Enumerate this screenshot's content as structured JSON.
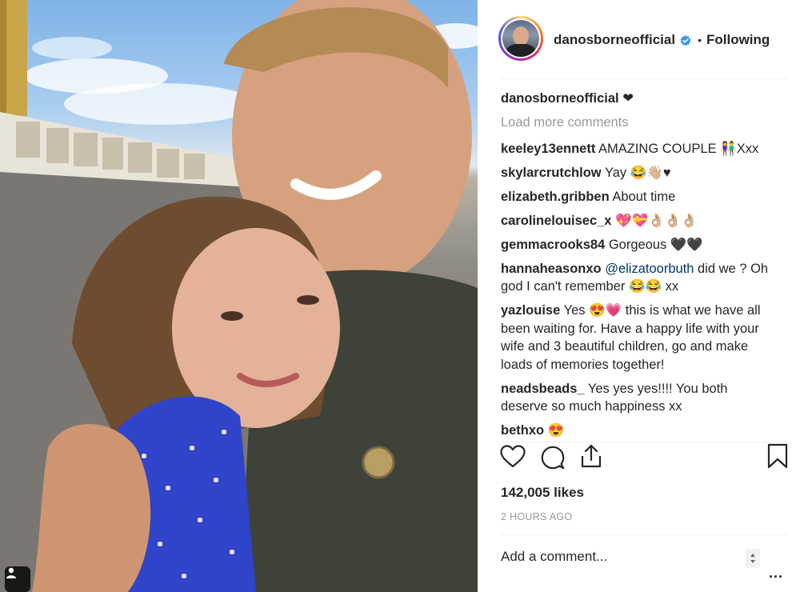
{
  "post": {
    "username": "danosborneofficial",
    "separator": "•",
    "follow_status": "Following",
    "likes": "142,005 likes",
    "time_ago": "2 HOURS AGO",
    "add_comment_placeholder": "Add a comment...",
    "more_options": "...",
    "load_more": "Load more comments"
  },
  "caption": {
    "user": "danosborneofficial",
    "text": "❤"
  },
  "comments": [
    {
      "user": "keeley13ennett",
      "text": "AMAZING COUPLE 👫Xxx"
    },
    {
      "user": "skylarcrutchlow",
      "text": "Yay 😂👋🏼♥"
    },
    {
      "user": "elizabeth.gribben",
      "text": "About time"
    },
    {
      "user": "carolinelouisec_x",
      "text": "💖💝👌🏼👌🏼👌🏼"
    },
    {
      "user": "gemmacrooks84",
      "text": "Gorgeous 🖤🖤"
    },
    {
      "user": "hannaheasonxo",
      "mention": "@elizatoorbuth",
      "text": "did we ? Oh god I can't remember 😂😂 xx"
    },
    {
      "user": "yazlouise",
      "text": "Yes 😍💗 this is what we have all been waiting for. Have a happy life with your wife and 3 beautiful children, go and make loads of memories together!"
    },
    {
      "user": "neadsbeads_",
      "text": "Yes yes yes!!!! You both deserve so much happiness xx"
    },
    {
      "user": "bethxo",
      "text": "😍"
    }
  ],
  "icons": {
    "like": "heart-icon",
    "comment": "comment-icon",
    "share": "share-icon",
    "save": "bookmark-icon",
    "verified": "verified-badge-icon",
    "tag": "user-tag-icon"
  },
  "colors": {
    "verified": "#3897f0",
    "mention": "#003569",
    "muted": "#999999",
    "text": "#262626"
  }
}
